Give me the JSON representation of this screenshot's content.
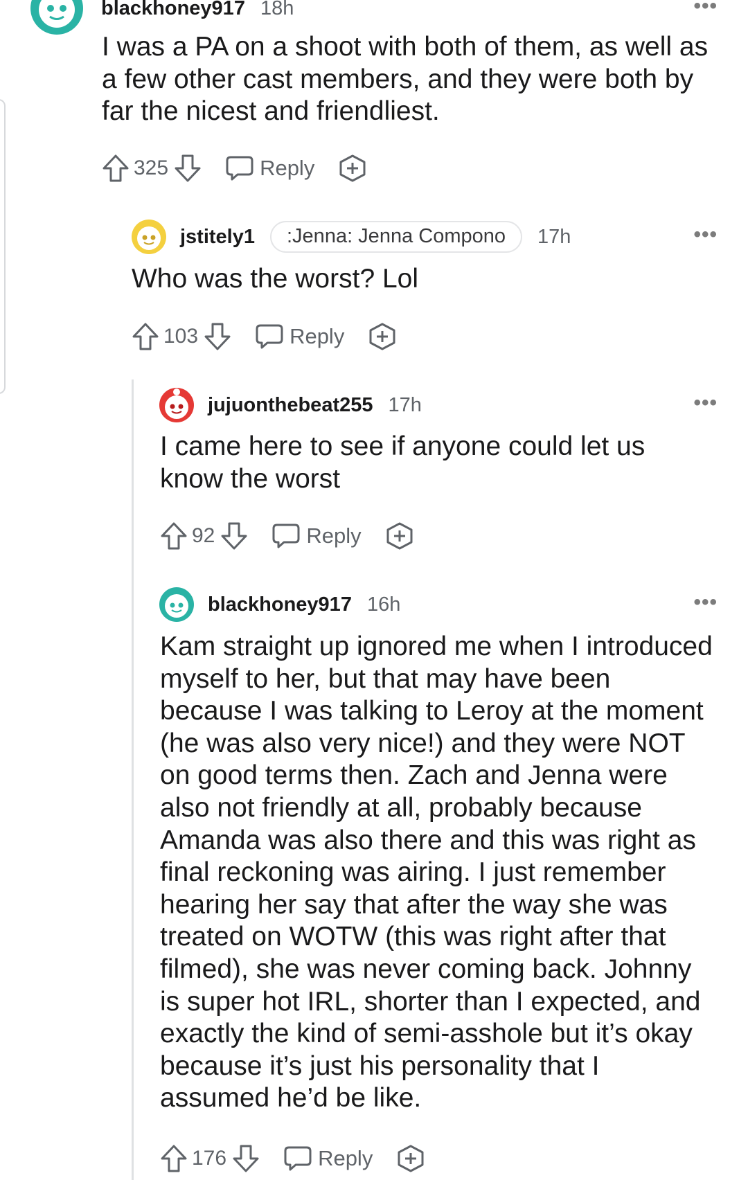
{
  "comments": [
    {
      "username": "blackhoney917",
      "time": "18h",
      "body": "I was a PA on a shoot with both of them, as well as a few other cast members, and they were both by far the nicest and friendliest.",
      "score": "325",
      "reply_label": "Reply",
      "avatar_color": "#2ab3a5"
    },
    {
      "username": "jstitely1",
      "flair": ":Jenna: Jenna Compono",
      "time": "17h",
      "body": "Who was the worst? Lol",
      "score": "103",
      "reply_label": "Reply",
      "avatar_color": "#f4d03f"
    },
    {
      "username": "jujuonthebeat255",
      "time": "17h",
      "body": "I came here to see if anyone could let us know the worst",
      "score": "92",
      "reply_label": "Reply",
      "avatar_color": "#e53935"
    },
    {
      "username": "blackhoney917",
      "time": "16h",
      "body": "Kam straight up ignored me when I introduced myself to her, but that may have been because I was talking to Leroy at the moment (he was also very nice!) and they were NOT on good terms then. Zach and Jenna were also not friendly at all, probably because Amanda was also there and this was right as final reckoning was airing. I just remember hearing her say that after the way she was treated on WOTW (this was right after that filmed), she was never coming back. Johnny is super hot IRL, shorter than I expected, and exactly the kind of semi-asshole but it’s okay because it’s just his personality that I assumed he’d be like.",
      "score": "176",
      "reply_label": "Reply",
      "avatar_color": "#2ab3a5"
    }
  ],
  "more_label": "•••",
  "colors": {
    "text": "#1a1a1b",
    "meta": "#5f6368",
    "thread_line": "#dfe1e3"
  }
}
